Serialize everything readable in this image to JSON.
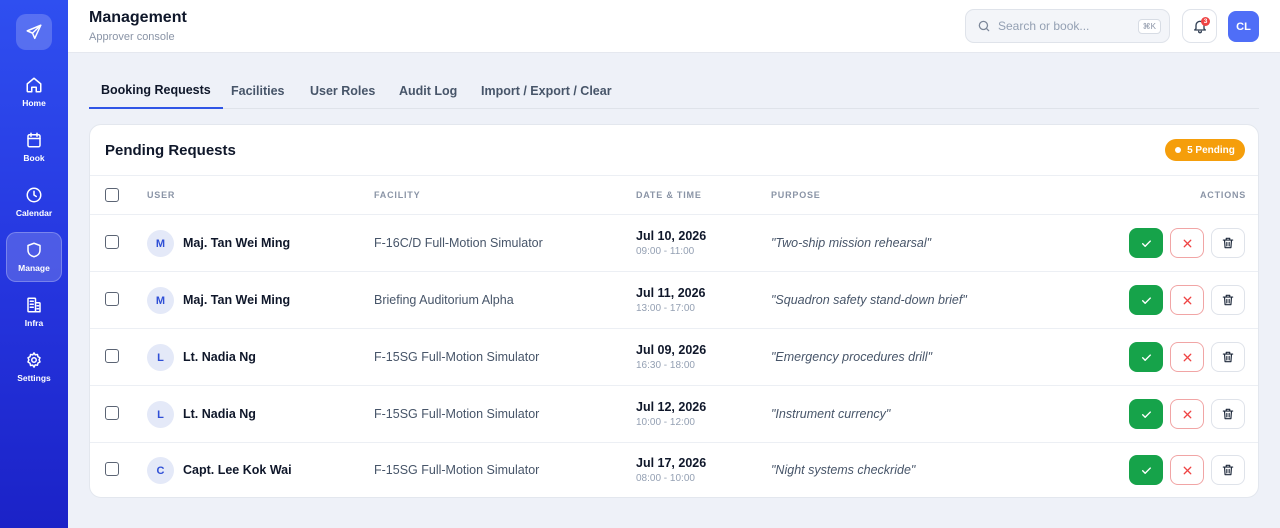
{
  "sidebar": {
    "logo_icon": "send-icon",
    "items": [
      {
        "label": "Home",
        "icon": "home-icon",
        "active": false
      },
      {
        "label": "Book",
        "icon": "calendar-book-icon",
        "active": false
      },
      {
        "label": "Calendar",
        "icon": "clock-icon",
        "active": false
      },
      {
        "label": "Manage",
        "icon": "shield-icon",
        "active": true
      },
      {
        "label": "Infra",
        "icon": "building-icon",
        "active": false
      },
      {
        "label": "Settings",
        "icon": "gear-icon",
        "active": false
      }
    ]
  },
  "header": {
    "title": "Management",
    "subtitle": "Approver console",
    "search_placeholder": "Search or book...",
    "search_shortcut": "⌘K",
    "notification_count": "3",
    "user_initials": "CL"
  },
  "tabs": [
    {
      "label": "Booking Requests",
      "active": true
    },
    {
      "label": "Facilities",
      "active": false
    },
    {
      "label": "User Roles",
      "active": false
    },
    {
      "label": "Audit Log",
      "active": false
    },
    {
      "label": "Import / Export / Clear",
      "active": false
    }
  ],
  "card": {
    "title": "Pending Requests",
    "badge": "5 Pending",
    "columns": {
      "user": "USER",
      "facility": "FACILITY",
      "datetime": "DATE & TIME",
      "purpose": "PURPOSE",
      "actions": "ACTIONS"
    }
  },
  "requests": [
    {
      "initial": "M",
      "name": "Maj. Tan Wei Ming",
      "facility": "F-16C/D Full-Motion Simulator",
      "date": "Jul 10, 2026",
      "time": "09:00 - 11:00",
      "purpose": "\"Two-ship mission rehearsal\""
    },
    {
      "initial": "M",
      "name": "Maj. Tan Wei Ming",
      "facility": "Briefing Auditorium Alpha",
      "date": "Jul 11, 2026",
      "time": "13:00 - 17:00",
      "purpose": "\"Squadron safety stand-down brief\""
    },
    {
      "initial": "L",
      "name": "Lt. Nadia Ng",
      "facility": "F-15SG Full-Motion Simulator",
      "date": "Jul 09, 2026",
      "time": "16:30 - 18:00",
      "purpose": "\"Emergency procedures drill\""
    },
    {
      "initial": "L",
      "name": "Lt. Nadia Ng",
      "facility": "F-15SG Full-Motion Simulator",
      "date": "Jul 12, 2026",
      "time": "10:00 - 12:00",
      "purpose": "\"Instrument currency\""
    },
    {
      "initial": "C",
      "name": "Capt. Lee Kok Wai",
      "facility": "F-15SG Full-Motion Simulator",
      "date": "Jul 17, 2026",
      "time": "08:00 - 10:00",
      "purpose": "\"Night systems checkride\""
    }
  ],
  "colors": {
    "sidebar_top": "#2f4ff0",
    "sidebar_bottom": "#1b22c7",
    "accent": "#2f55e6",
    "approve": "#16a34a",
    "reject": "#ef4444",
    "pending": "#f59e0b"
  }
}
